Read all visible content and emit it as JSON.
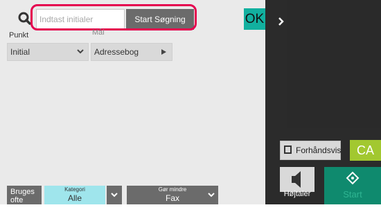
{
  "search": {
    "placeholder": "Indtast initialer",
    "start_label": "Start Søgning",
    "ok_label": "OK"
  },
  "fields": {
    "punkt_label": "Punkt",
    "mal_label": "Mål",
    "initial_value": "Initial",
    "adressebog_value": "Adressebog"
  },
  "bottom": {
    "bruges_line1": "Bruges",
    "bruges_line2": "ofte",
    "kategori_title": "Kategori",
    "kategori_value": "Alle",
    "gor_title": "Gør mindre",
    "gor_value": "Fax"
  },
  "side": {
    "preview_label": "Forhåndsvis",
    "ca_label": "CA",
    "speaker_label": "Højtaler",
    "start_label": "Start"
  },
  "icons": {
    "search": "search-icon",
    "panel_toggle": "chevron-right-icon",
    "preview": "preview-icon",
    "speaker": "speaker-icon",
    "start": "start-diamond-icon"
  },
  "colors": {
    "highlight": "#e5004f",
    "ok": "#12b09f",
    "category": "#9fe5ec",
    "ca": "#a2c830",
    "start": "#0f8a6e"
  }
}
